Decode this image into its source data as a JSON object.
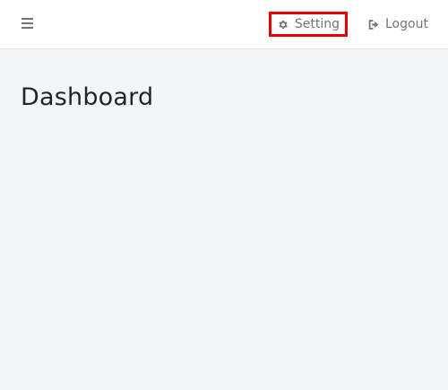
{
  "header": {
    "menu_icon": "hamburger-icon",
    "setting": {
      "label": "Setting",
      "icon": "gear-icon",
      "highlight_color": "#e60000"
    },
    "logout": {
      "label": "Logout",
      "icon": "sign-out-icon"
    }
  },
  "main": {
    "title": "Dashboard"
  },
  "colors": {
    "header_bg": "#ffffff",
    "body_bg": "#f3f5f9",
    "nav_text": "#6c757d",
    "title_text": "#212529"
  }
}
